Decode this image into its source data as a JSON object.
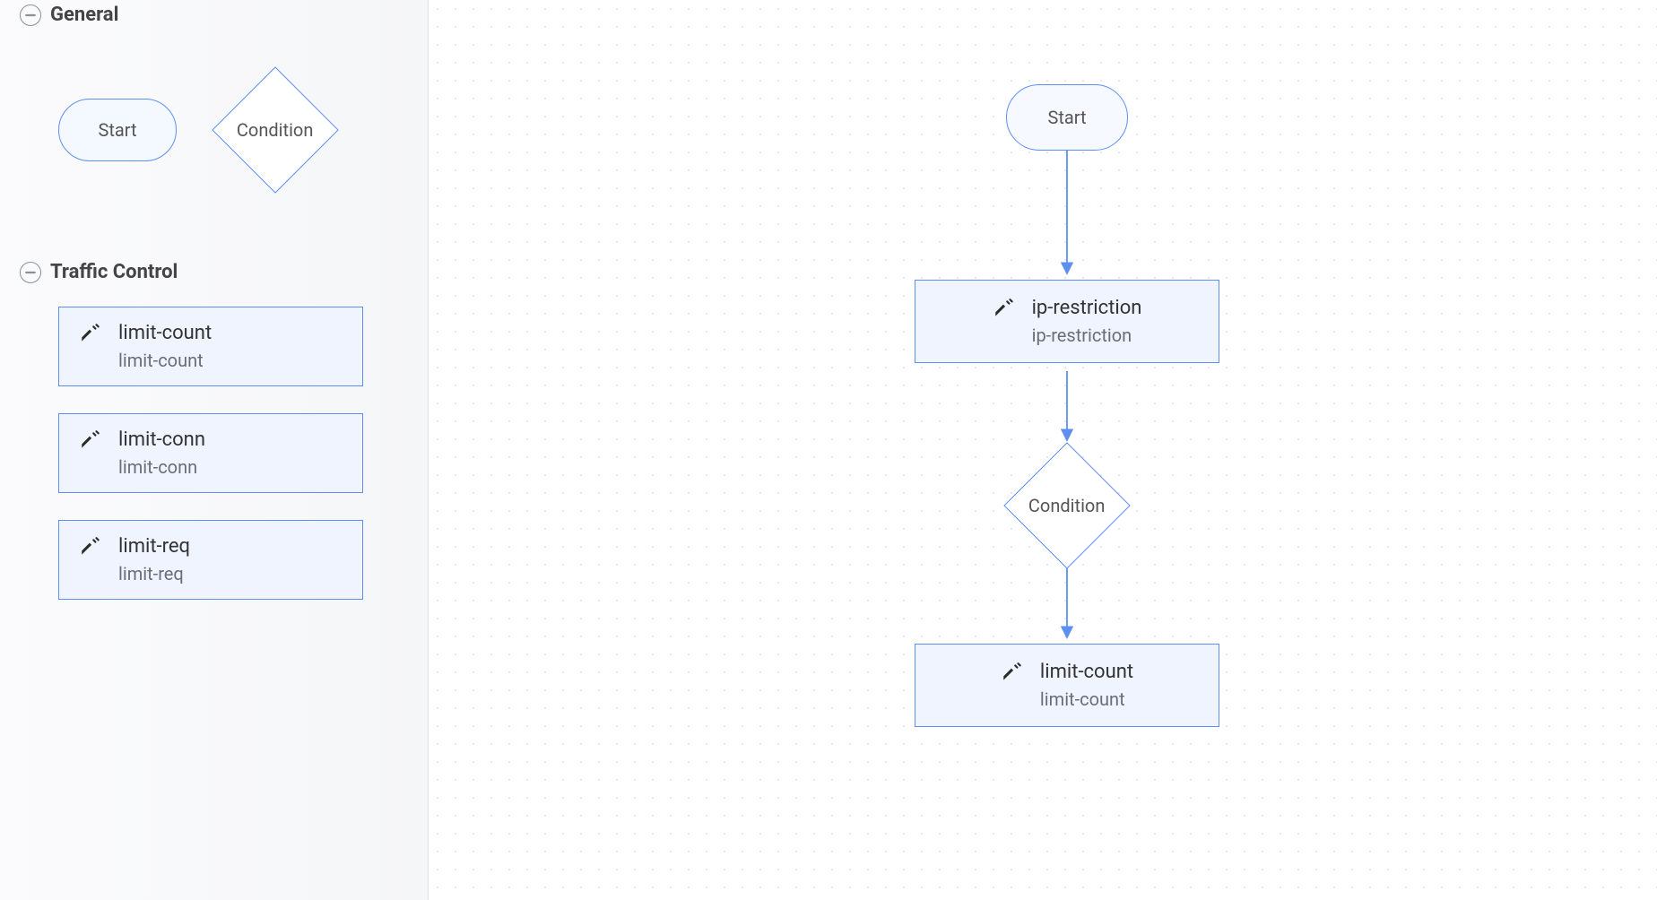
{
  "sidebar": {
    "sections": [
      {
        "title": "General",
        "shapes": {
          "start_label": "Start",
          "condition_label": "Condition"
        }
      },
      {
        "title": "Traffic Control",
        "plugins": [
          {
            "title": "limit-count",
            "sub": "limit-count"
          },
          {
            "title": "limit-conn",
            "sub": "limit-conn"
          },
          {
            "title": "limit-req",
            "sub": "limit-req"
          }
        ]
      }
    ]
  },
  "canvas": {
    "start_label": "Start",
    "condition_label": "Condition",
    "nodes": {
      "ip_restriction": {
        "title": "ip-restriction",
        "sub": "ip-restriction"
      },
      "limit_count": {
        "title": "limit-count",
        "sub": "limit-count"
      }
    }
  },
  "colors": {
    "node_border": "#5d8ff0",
    "node_fill": "#eff4ff"
  }
}
